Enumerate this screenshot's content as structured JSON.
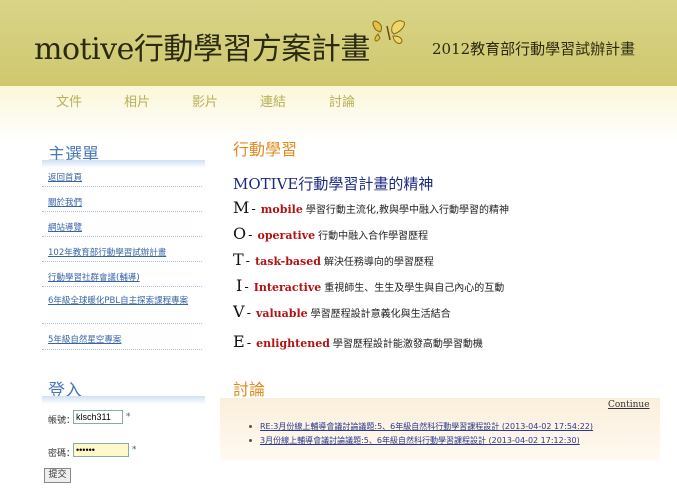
{
  "header": {
    "site_title": "motive行動學習方案計畫",
    "subtitle": "2012教育部行動學習試辦計畫"
  },
  "nav": {
    "items": [
      "文件",
      "相片",
      "影片",
      "連結",
      "討論"
    ]
  },
  "sidebar": {
    "menu_heading": "主選單",
    "menu_items": [
      "返回首頁",
      "關於我們",
      "網站導覽",
      "102年教育部行動學習試辦計畫",
      "行動學習社群會議(輔導)",
      "6年級全球暖化PBL自主探索課程專案",
      "5年級自然星空專案"
    ],
    "login_heading": "登入",
    "account_label": "帳號：",
    "account_value": "klsch311",
    "password_label": "密碼：",
    "password_value": "••••••",
    "required_mark": "*",
    "submit_label": "提交"
  },
  "main": {
    "heading": "行動學習",
    "motive_title": "MOTIVE行動學習計畫的精神",
    "principles": [
      {
        "letter": "M",
        "key": "mobile",
        "desc": "學習行動主流化,教與學中融入行動學習的精神"
      },
      {
        "letter": "O",
        "key": "operative",
        "desc": "行動中融入合作學習歷程"
      },
      {
        "letter": "T",
        "key": "task-based",
        "desc": "解決任務導向的學習歷程"
      },
      {
        "letter": "I",
        "key": "Interactive",
        "desc": "重視師生、生生及學生與自己內心的互動"
      },
      {
        "letter": "V",
        "key": "valuable",
        "desc": "學習歷程設計意義化與生活結合"
      },
      {
        "letter": "E",
        "key": "enlightened",
        "desc": "學習歷程設計能激發高動學習動機"
      }
    ],
    "dash": "-",
    "forum_heading": "討論",
    "continue_label": "Continue",
    "forum_posts": [
      "RE:3月份線上輔導會議討論議題:5、6年級自然科行動學習課程設計 (2013-04-02 17:54:22)",
      "3月份線上輔導會議討論議題:5、6年級自然科行動學習課程設計 (2013-04-02 17:12:30)"
    ]
  }
}
